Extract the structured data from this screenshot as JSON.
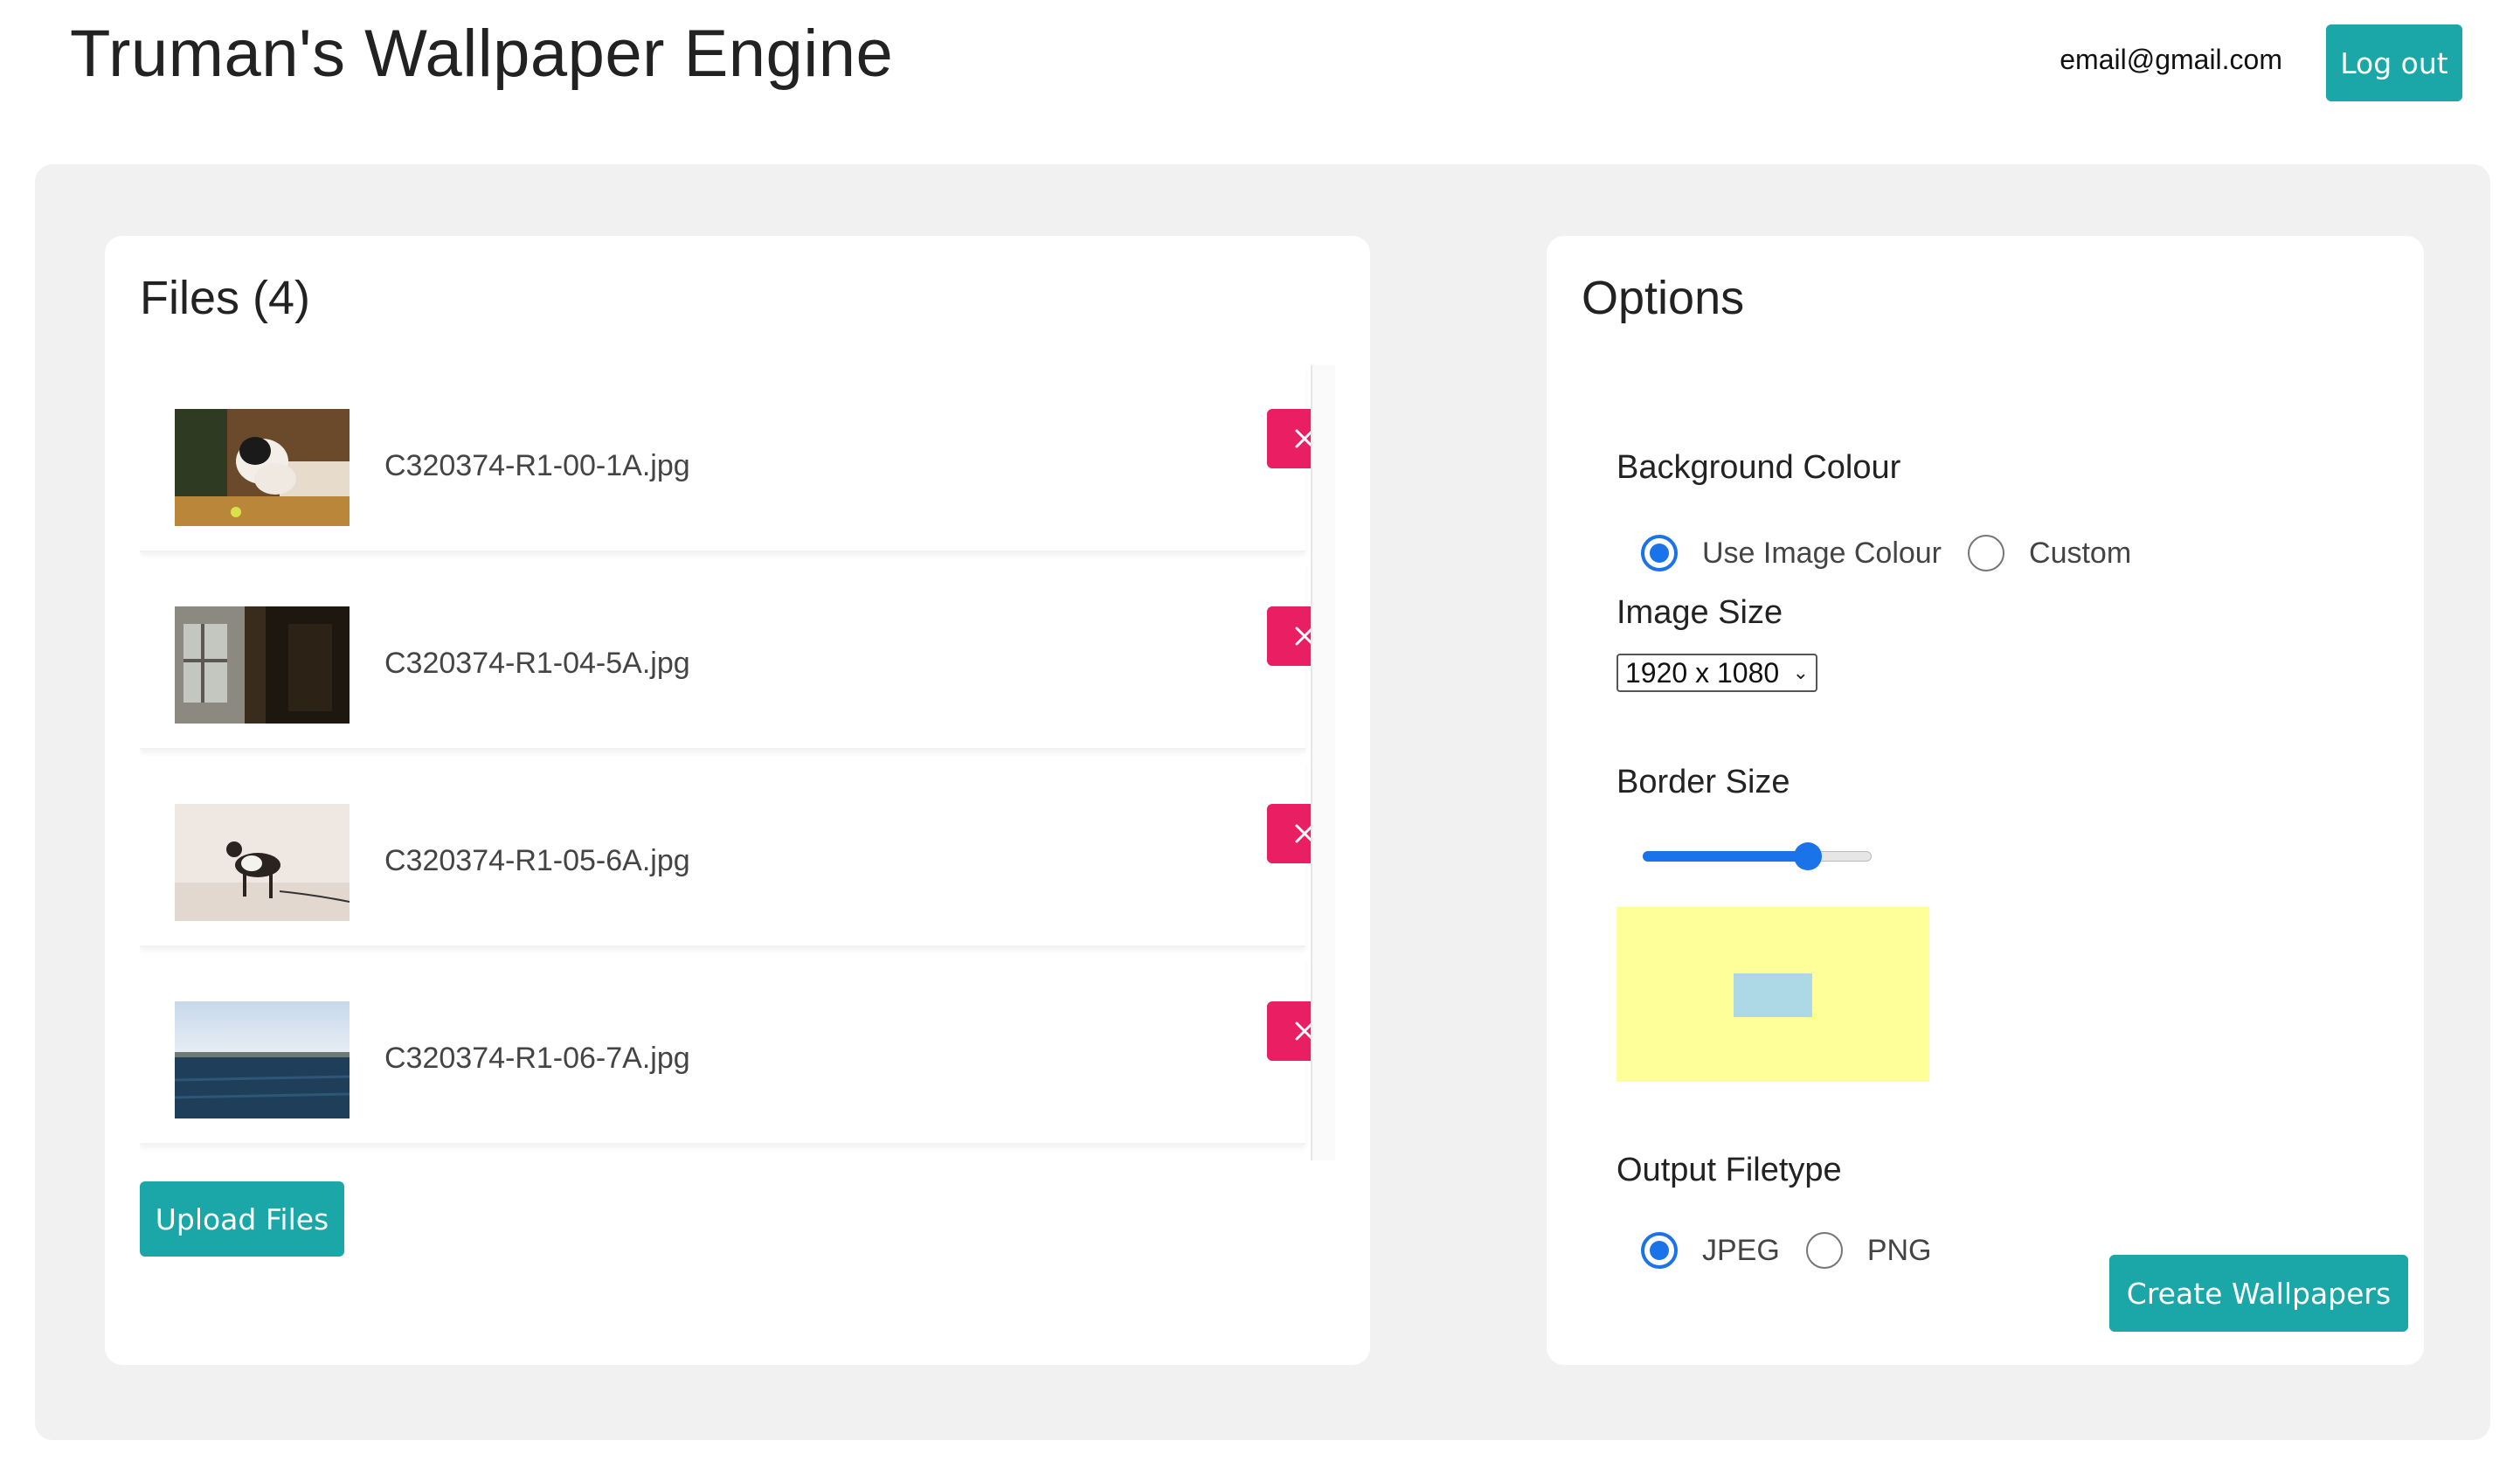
{
  "header": {
    "title": "Truman's Wallpaper Engine",
    "email": "email@gmail.com",
    "logout_label": "Log out"
  },
  "files": {
    "title": "Files (4)",
    "items": [
      {
        "name": "C320374-R1-00-1A.jpg",
        "thumbnail": "dog-on-couch"
      },
      {
        "name": "C320374-R1-04-5A.jpg",
        "thumbnail": "window-interior"
      },
      {
        "name": "C320374-R1-05-6A.jpg",
        "thumbnail": "dog-in-snow"
      },
      {
        "name": "C320374-R1-06-7A.jpg",
        "thumbnail": "sea-horizon"
      }
    ],
    "remove_icon": "close-icon",
    "upload_label": "Upload Files"
  },
  "options": {
    "title": "Options",
    "background_colour": {
      "label": "Background Colour",
      "choices": [
        "Use Image Colour",
        "Custom"
      ],
      "selected": "Use Image Colour"
    },
    "image_size": {
      "label": "Image Size",
      "selected": "1920 x 1080"
    },
    "border_size": {
      "label": "Border Size",
      "value_fraction": 0.72
    },
    "preview_colors": {
      "border": "#ffff99",
      "image": "#add8e6"
    },
    "output_filetype": {
      "label": "Output Filetype",
      "choices": [
        "JPEG",
        "PNG"
      ],
      "selected": "JPEG"
    },
    "create_label": "Create Wallpapers"
  },
  "colors": {
    "accent": "#1ba6a8",
    "danger": "#e91e63",
    "radio": "#1a73e8"
  }
}
